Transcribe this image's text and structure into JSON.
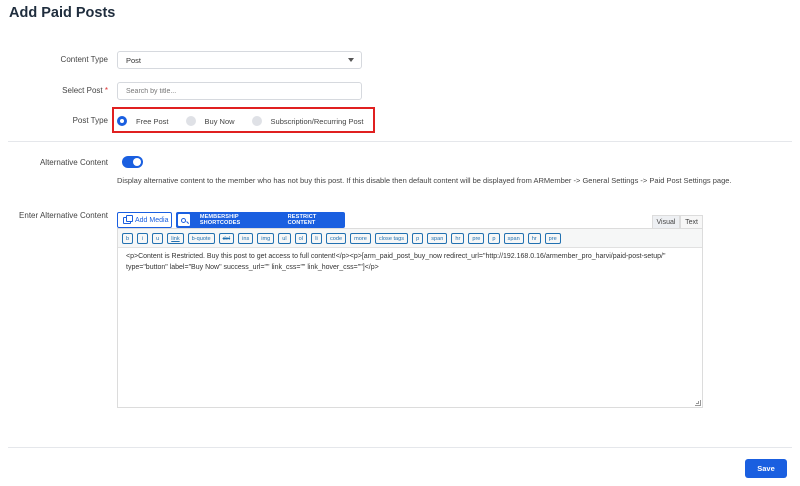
{
  "page": {
    "title": "Add Paid Posts"
  },
  "form": {
    "content_type": {
      "label": "Content Type",
      "value": "Post"
    },
    "select_post": {
      "label": "Select Post",
      "required_mark": "*",
      "placeholder": "Search by title..."
    },
    "post_type": {
      "label": "Post Type",
      "options": [
        {
          "label": "Free Post",
          "selected": true
        },
        {
          "label": "Buy Now",
          "selected": false
        },
        {
          "label": "Subscription/Recurring Post",
          "selected": false
        }
      ]
    },
    "alternative_content": {
      "label": "Alternative Content",
      "enabled": true,
      "help": "Display alternative content to the member who has not buy this post. If this disable then default content will be displayed from ARMember -> General Settings -> Paid Post Settings page."
    },
    "enter_alternative_content": {
      "label": "Enter Alternative Content"
    }
  },
  "editor": {
    "add_media_label": "Add Media",
    "membership_shortcodes_label": "MEMBERSHIP SHORTCODES",
    "restrict_content_label": "RESTRICT CONTENT",
    "tabs": {
      "visual": "Visual",
      "text": "Text"
    },
    "quicktags": [
      "b",
      "i",
      "u",
      "link",
      "b-quote",
      "del",
      "ins",
      "img",
      "ul",
      "ol",
      "li",
      "code",
      "more",
      "close tags",
      "p",
      "span",
      "hr",
      "pre",
      "p",
      "span",
      "hr",
      "pre"
    ],
    "content": "<p>Content is Restricted. Buy this post to get access to full content!</p><p>[arm_paid_post_buy_now redirect_url=\"http://192.168.0.16/armember_pro_harvi/paid-post-setup/\" type=\"button\" label=\"Buy Now\" success_url=\"\" link_css=\"\" link_hover_css=\"\"]</p>"
  },
  "actions": {
    "save_label": "Save"
  },
  "colors": {
    "primary": "#1a5fe0",
    "highlight_border": "#e02020"
  }
}
